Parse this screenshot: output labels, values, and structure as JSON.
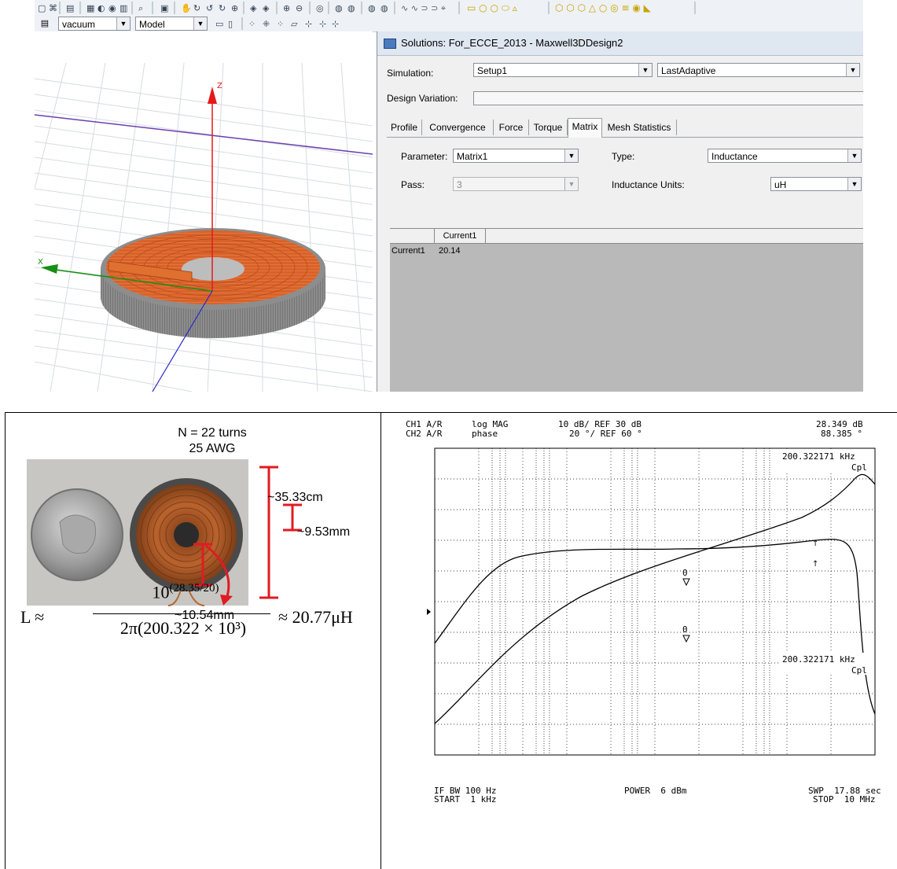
{
  "toolbar": {
    "material_value": "vacuum",
    "model_value": "Model"
  },
  "viewport": {
    "z_axis_label": "Z",
    "x_axis_label": "X"
  },
  "solutions": {
    "window_title": "Solutions: For_ECCE_2013 - Maxwell3DDesign2",
    "simulation_label": "Simulation:",
    "simulation_setup": "Setup1",
    "simulation_pass": "LastAdaptive",
    "design_variation_label": "Design Variation:",
    "design_variation_value": "",
    "tabs": [
      "Profile",
      "Convergence",
      "Force",
      "Torque",
      "Matrix",
      "Mesh Statistics"
    ],
    "active_tab": "Matrix",
    "parameter_label": "Parameter:",
    "parameter_value": "Matrix1",
    "type_label": "Type:",
    "type_value": "Inductance",
    "pass_label": "Pass:",
    "pass_value": "3",
    "units_label": "Inductance Units:",
    "units_value": "uH",
    "grid": {
      "column_header": "Current1",
      "row_header": "Current1",
      "value": "20.14"
    }
  },
  "photo": {
    "turns": "N = 22 turns",
    "awg": "25 AWG",
    "dim_outer": "~35.33cm",
    "dim_inner": "~9.53mm",
    "dim_winding": "~10.54mm"
  },
  "formula": {
    "lhs": "L ≈",
    "numerator_base": "10",
    "numerator_exp": "(28.35/20)",
    "denominator": "2π(200.322 × 10³)",
    "rhs": "≈ 20.77μH"
  },
  "analyzer": {
    "ch1_label": "CH1 A/R",
    "ch1_format": "log MAG",
    "ch1_scale": "10 dB/ REF 30 dB",
    "ch1_marker": "28.349 dB",
    "ch2_label": "CH2 A/R",
    "ch2_format": "phase",
    "ch2_scale": "20 °/ REF 60 °",
    "ch2_marker": "88.385 °",
    "marker1_freq": "200.322171 kHz",
    "marker1_tag": "Cpl",
    "marker2_freq": "200.322171 kHz",
    "marker2_tag": "Cpl",
    "marker_zero": "0",
    "ifbw": "IF BW 100 Hz",
    "start": "START  1 kHz",
    "power": "POWER  6 dBm",
    "swp": "SWP  17.88 sec",
    "stop": "STOP  10 MHz"
  },
  "colors": {
    "coil_orange": "#d9622a",
    "annotation_red": "#e11b22",
    "axis_red": "#e41a1a",
    "axis_green": "#159015",
    "axis_blue": "#2a2ac8"
  }
}
